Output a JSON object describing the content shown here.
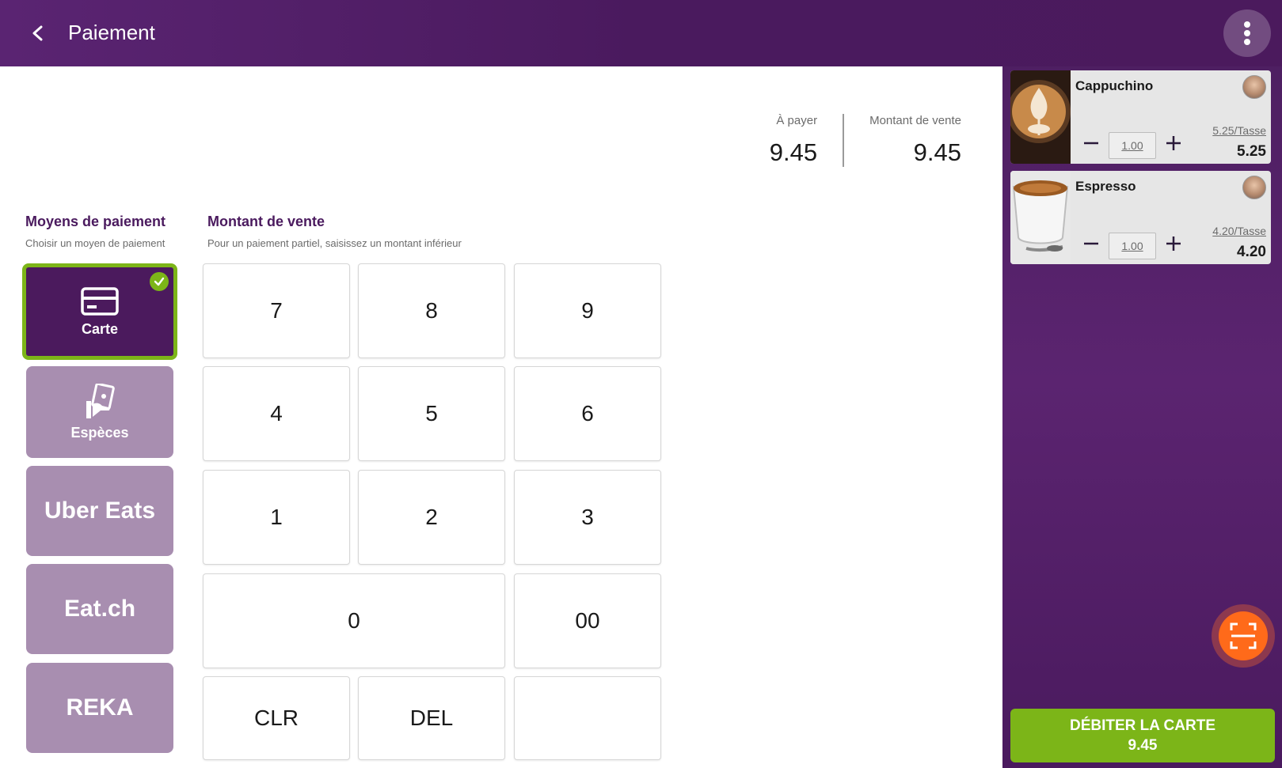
{
  "header": {
    "title": "Paiement"
  },
  "totals": {
    "to_pay_label": "À payer",
    "to_pay_value": "9.45",
    "sale_amount_label": "Montant de vente",
    "sale_amount_value": "9.45"
  },
  "payment_methods": {
    "title": "Moyens de paiement",
    "subtitle": "Choisir un moyen de paiement",
    "items": [
      {
        "label": "Carte",
        "icon": "credit-card-icon",
        "selected": true
      },
      {
        "label": "Espèces",
        "icon": "cash-hand-icon",
        "selected": false
      },
      {
        "label": "Uber Eats",
        "selected": false
      },
      {
        "label": "Eat.ch",
        "selected": false
      },
      {
        "label": "REKA",
        "selected": false
      }
    ]
  },
  "amount": {
    "title": "Montant de vente",
    "subtitle": "Pour un paiement partiel, saisissez un montant inférieur"
  },
  "keypad": {
    "k7": "7",
    "k8": "8",
    "k9": "9",
    "k4": "4",
    "k5": "5",
    "k6": "6",
    "k1": "1",
    "k2": "2",
    "k3": "3",
    "k0": "0",
    "k00": "00",
    "clr": "CLR",
    "del": "DEL"
  },
  "cart": {
    "items": [
      {
        "name": "Cappuchino",
        "quantity": "1.00",
        "unit_price": "5.25/Tasse",
        "total": "5.25"
      },
      {
        "name": "Espresso",
        "quantity": "1.00",
        "unit_price": "4.20/Tasse",
        "total": "4.20"
      }
    ]
  },
  "charge_button": {
    "label": "DÉBITER LA CARTE",
    "amount": "9.45"
  },
  "colors": {
    "header": "#4a1a5e",
    "accent_purple": "#4b1a5d",
    "method_bg": "#a88eb0",
    "selected_border": "#7cb518",
    "charge_button": "#7cb518",
    "scan_button": "#ff6a1a"
  }
}
